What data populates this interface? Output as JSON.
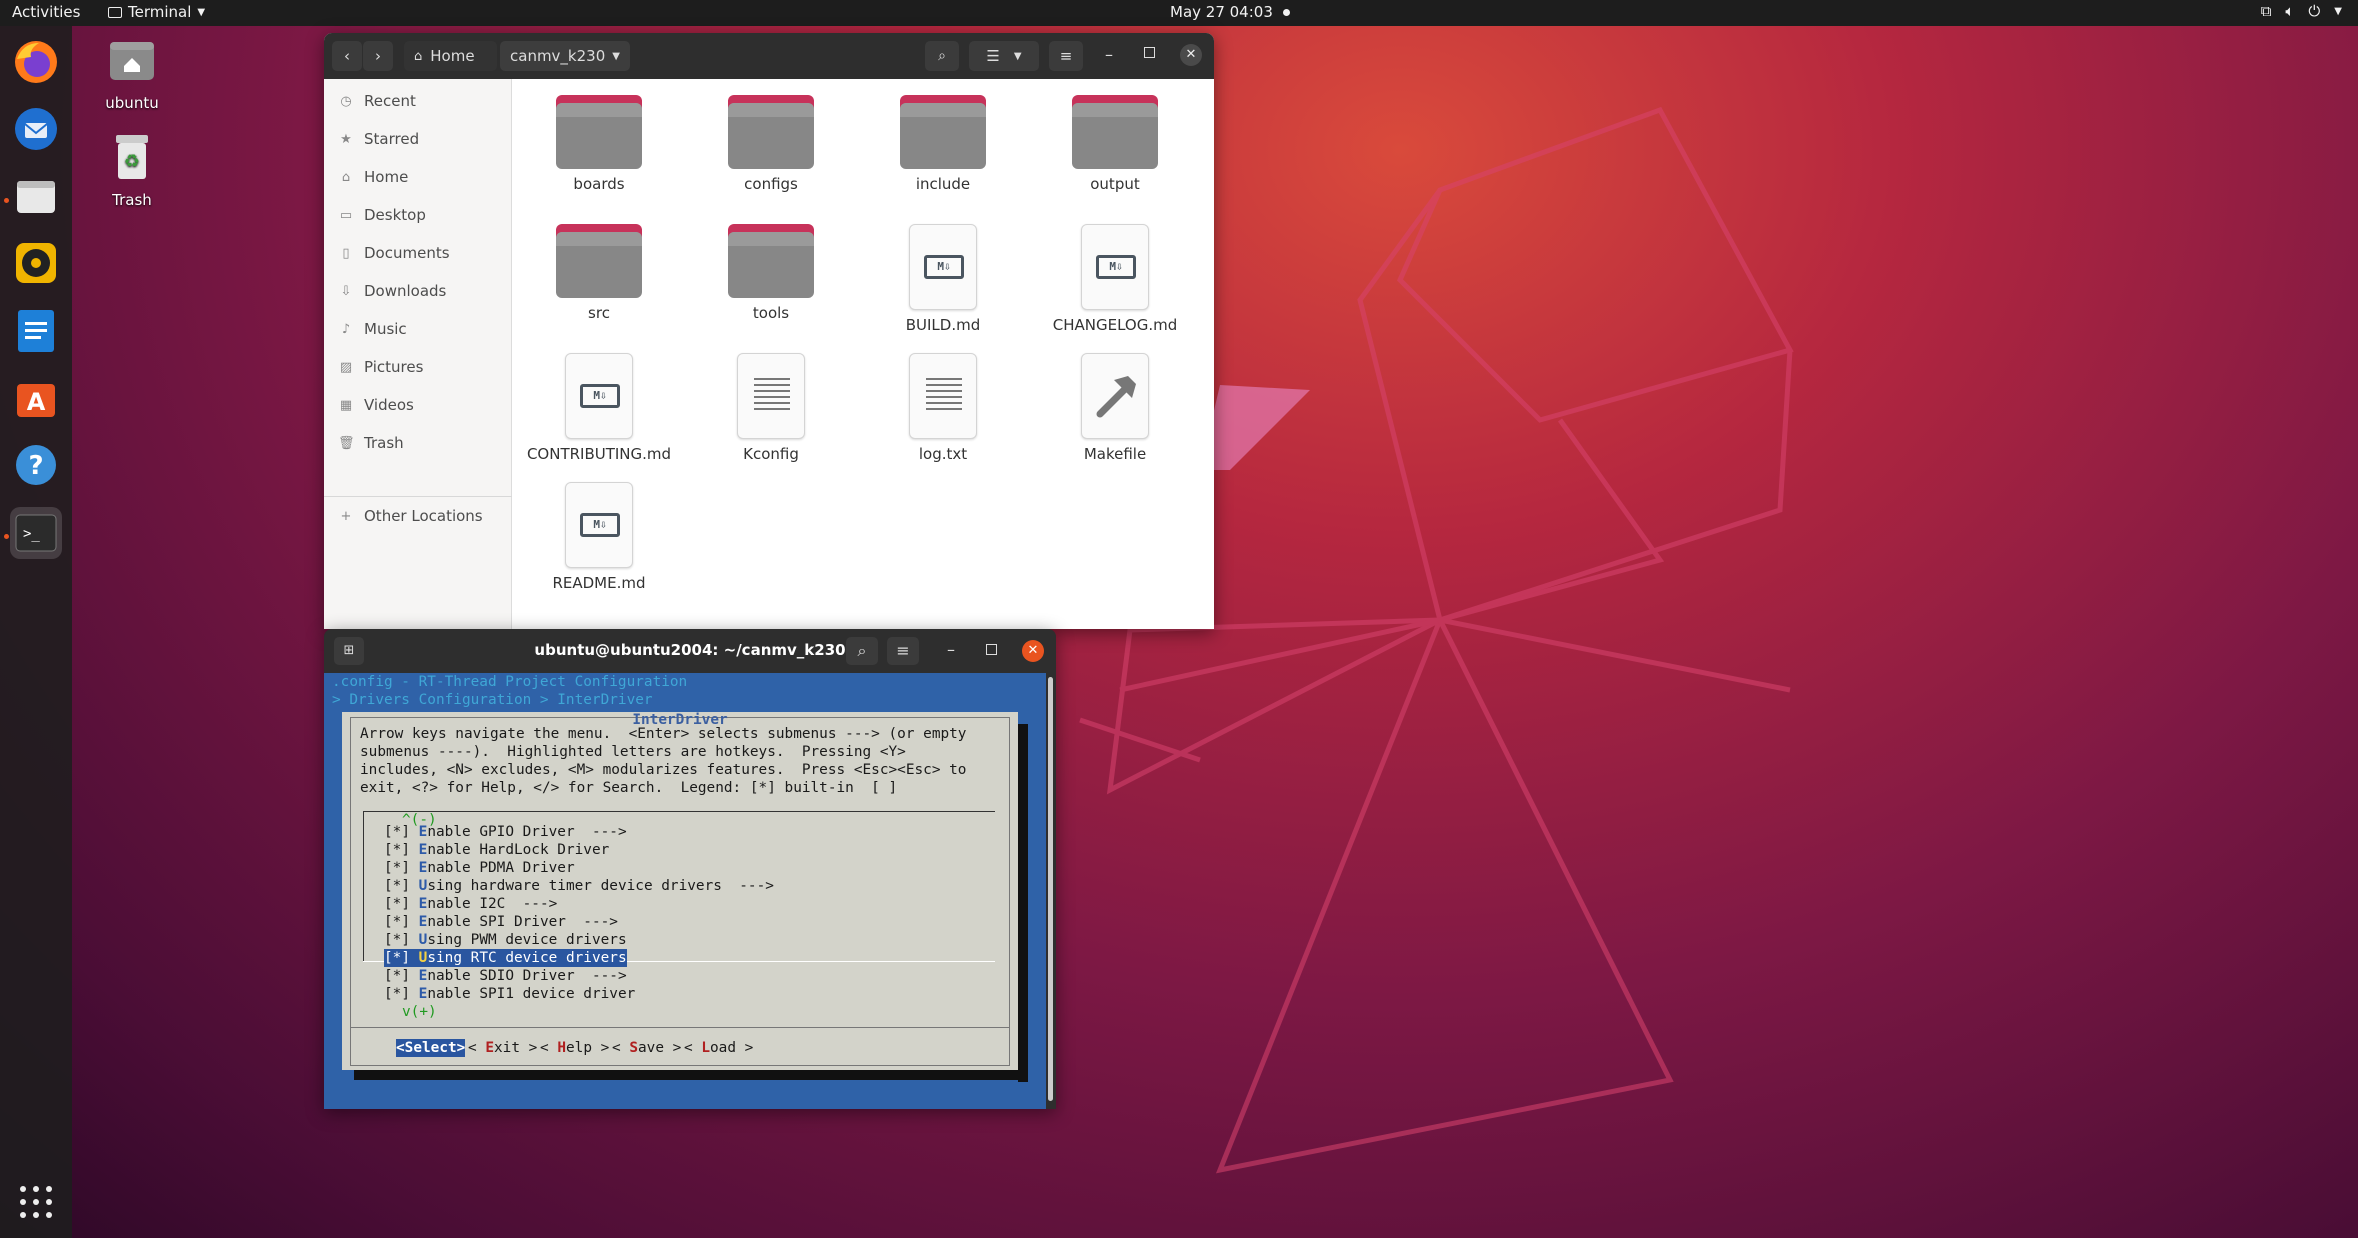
{
  "topbar": {
    "activities": "Activities",
    "app_name": "Terminal",
    "clock": "May 27  04:03"
  },
  "desktop": {
    "icons": [
      {
        "label": "ubuntu"
      },
      {
        "label": "Trash"
      }
    ]
  },
  "file_manager": {
    "path": {
      "home": "Home",
      "current": "canmv_k230"
    },
    "sidebar": [
      {
        "label": "Recent",
        "icon": "clock-icon"
      },
      {
        "label": "Starred",
        "icon": "star-icon"
      },
      {
        "label": "Home",
        "icon": "home-icon"
      },
      {
        "label": "Desktop",
        "icon": "desktop-icon"
      },
      {
        "label": "Documents",
        "icon": "document-icon"
      },
      {
        "label": "Downloads",
        "icon": "download-icon"
      },
      {
        "label": "Music",
        "icon": "music-icon"
      },
      {
        "label": "Pictures",
        "icon": "picture-icon"
      },
      {
        "label": "Videos",
        "icon": "video-icon"
      },
      {
        "label": "Trash",
        "icon": "trash-icon"
      },
      {
        "label": "Other Locations",
        "icon": "plus-icon"
      }
    ],
    "files": [
      {
        "name": "boards",
        "type": "folder"
      },
      {
        "name": "configs",
        "type": "folder"
      },
      {
        "name": "include",
        "type": "folder"
      },
      {
        "name": "output",
        "type": "folder"
      },
      {
        "name": "src",
        "type": "folder"
      },
      {
        "name": "tools",
        "type": "folder"
      },
      {
        "name": "BUILD.md",
        "type": "markdown"
      },
      {
        "name": "CHANGELOG.md",
        "type": "markdown"
      },
      {
        "name": "CONTRIBUTING.md",
        "type": "markdown"
      },
      {
        "name": "Kconfig",
        "type": "text"
      },
      {
        "name": "log.txt",
        "type": "text"
      },
      {
        "name": "Makefile",
        "type": "makefile"
      },
      {
        "name": "README.md",
        "type": "markdown"
      }
    ]
  },
  "terminal": {
    "title": "ubuntu@ubuntu2004: ~/canmv_k230",
    "breadcrumb_1": ".config - RT-Thread Project Configuration",
    "breadcrumb_2": "> Drivers Configuration > InterDriver",
    "dialog_title": "InterDriver",
    "help_lines": [
      "Arrow keys navigate the menu.  <Enter> selects submenus ---> (or empty",
      "submenus ----).  Highlighted letters are hotkeys.  Pressing <Y>",
      "includes, <N> excludes, <M> modularizes features.  Press <Esc><Esc> to",
      "exit, <?> for Help, </> for Search.  Legend: [*] built-in  [ ]"
    ],
    "scroll_up": "^(-)",
    "scroll_down": "v(+)",
    "menu_items": [
      {
        "box": "[*]",
        "hotkey": "E",
        "rest": "nable GPIO Driver  --->"
      },
      {
        "box": "[*]",
        "hotkey": "E",
        "rest": "nable HardLock Driver"
      },
      {
        "box": "[*]",
        "hotkey": "E",
        "rest": "nable PDMA Driver"
      },
      {
        "box": "[*]",
        "hotkey": "U",
        "rest": "sing hardware timer device drivers  --->"
      },
      {
        "box": "[*]",
        "hotkey": "E",
        "rest": "nable I2C  --->"
      },
      {
        "box": "[*]",
        "hotkey": "E",
        "rest": "nable SPI Driver  --->"
      },
      {
        "box": "[*]",
        "hotkey": "U",
        "rest": "sing PWM device drivers"
      },
      {
        "box": "[*]",
        "hotkey": "U",
        "rest": "sing RTC device drivers",
        "selected": true
      },
      {
        "box": "[*]",
        "hotkey": "E",
        "rest": "nable SDIO Driver  --->"
      },
      {
        "box": "[*]",
        "hotkey": "E",
        "rest": "nable SPI1 device driver"
      }
    ],
    "buttons": [
      {
        "label": "<Select>",
        "selected": true
      },
      {
        "pre": "< ",
        "hotkey": "E",
        "rest": "xit >"
      },
      {
        "pre": "< ",
        "hotkey": "H",
        "rest": "elp >"
      },
      {
        "pre": "< ",
        "hotkey": "S",
        "rest": "ave >"
      },
      {
        "pre": "< ",
        "hotkey": "L",
        "rest": "oad >"
      }
    ]
  },
  "colors": {
    "accent": "#e95420",
    "terminal_bg": "#2f62a8",
    "dialog_bg": "#d3d3ca",
    "folder_tab": "#c7325a"
  }
}
